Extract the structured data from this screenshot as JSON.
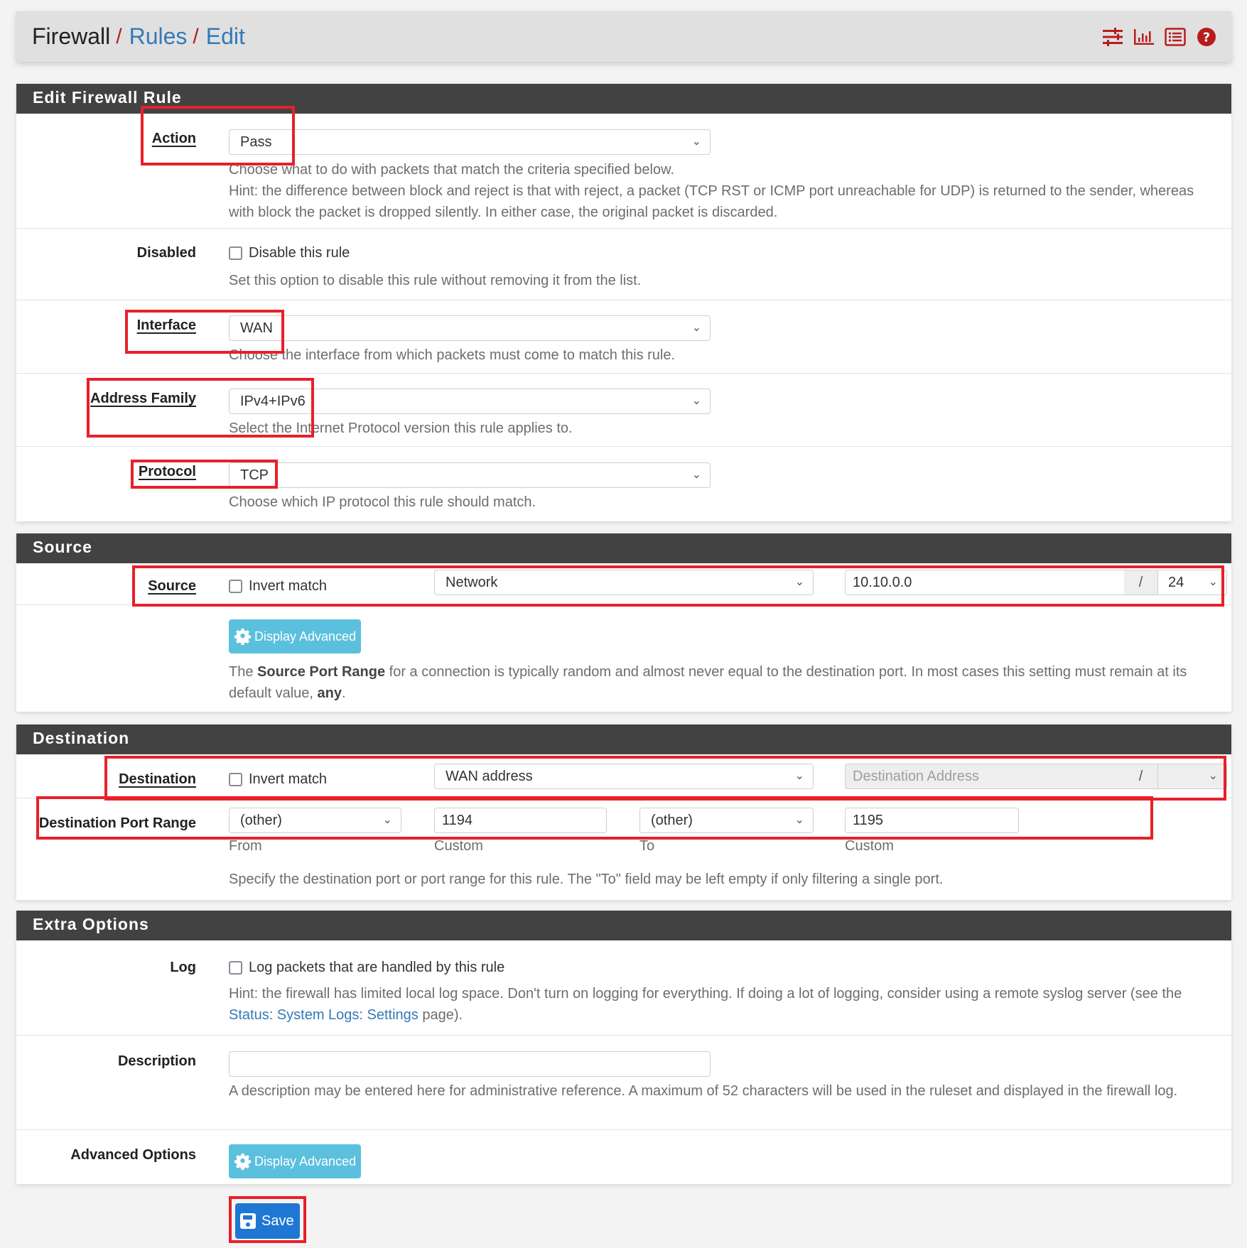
{
  "breadcrumb": {
    "items": [
      "Firewall",
      "Rules",
      "Edit"
    ],
    "separator": "/"
  },
  "header_icons": [
    "sliders-icon",
    "bar-chart-icon",
    "list-icon",
    "help-icon"
  ],
  "colors": {
    "accent_red": "#b71c1c",
    "link_blue": "#337ab7",
    "section_header": "#424242",
    "info_button": "#5bc0de",
    "primary_button": "#1e77d3",
    "annotation_box": "#e8202a"
  },
  "sections": {
    "edit": {
      "title": "Edit Firewall Rule",
      "action": {
        "label": "Action",
        "value": "Pass",
        "help1": "Choose what to do with packets that match the criteria specified below.",
        "help2": "Hint: the difference between block and reject is that with reject, a packet (TCP RST or ICMP port unreachable for UDP) is returned to the sender, whereas with block the packet is dropped silently. In either case, the original packet is discarded."
      },
      "disabled": {
        "label": "Disabled",
        "checkbox_label": "Disable this rule",
        "checked": false,
        "help": "Set this option to disable this rule without removing it from the list."
      },
      "interface": {
        "label": "Interface",
        "value": "WAN",
        "help": "Choose the interface from which packets must come to match this rule."
      },
      "address_family": {
        "label": "Address Family",
        "value": "IPv4+IPv6",
        "help": "Select the Internet Protocol version this rule applies to."
      },
      "protocol": {
        "label": "Protocol",
        "value": "TCP",
        "help": "Choose which IP protocol this rule should match."
      }
    },
    "source": {
      "title": "Source",
      "label": "Source",
      "invert_label": "Invert match",
      "invert_checked": false,
      "type": "Network",
      "address": "10.10.0.0",
      "slash": "/",
      "mask": "24",
      "advanced_button": "Display Advanced",
      "help_pre": "The ",
      "help_bold": "Source Port Range",
      "help_mid": " for a connection is typically random and almost never equal to the destination port. In most cases this setting must remain at its default value, ",
      "help_bold2": "any",
      "help_end": "."
    },
    "destination": {
      "title": "Destination",
      "label": "Destination",
      "invert_label": "Invert match",
      "invert_checked": false,
      "type": "WAN address",
      "address_placeholder": "Destination Address",
      "slash": "/",
      "mask": "",
      "port_range": {
        "label": "Destination Port Range",
        "from_select": "(other)",
        "from_custom": "1194",
        "to_select": "(other)",
        "to_custom": "1195",
        "sub_from": "From",
        "sub_custom1": "Custom",
        "sub_to": "To",
        "sub_custom2": "Custom",
        "help": "Specify the destination port or port range for this rule. The \"To\" field may be left empty if only filtering a single port."
      }
    },
    "extra": {
      "title": "Extra Options",
      "log": {
        "label": "Log",
        "checkbox_label": "Log packets that are handled by this rule",
        "checked": false,
        "help_pre": "Hint: the firewall has limited local log space. Don't turn on logging for everything. If doing a lot of logging, consider using a remote syslog server (see the ",
        "help_link": "Status: System Logs: Settings",
        "help_post": " page)."
      },
      "description": {
        "label": "Description",
        "value": "",
        "help": "A description may be entered here for administrative reference. A maximum of 52 characters will be used in the ruleset and displayed in the firewall log."
      },
      "advanced": {
        "label": "Advanced Options",
        "button": "Display Advanced"
      }
    }
  },
  "save_label": "Save"
}
